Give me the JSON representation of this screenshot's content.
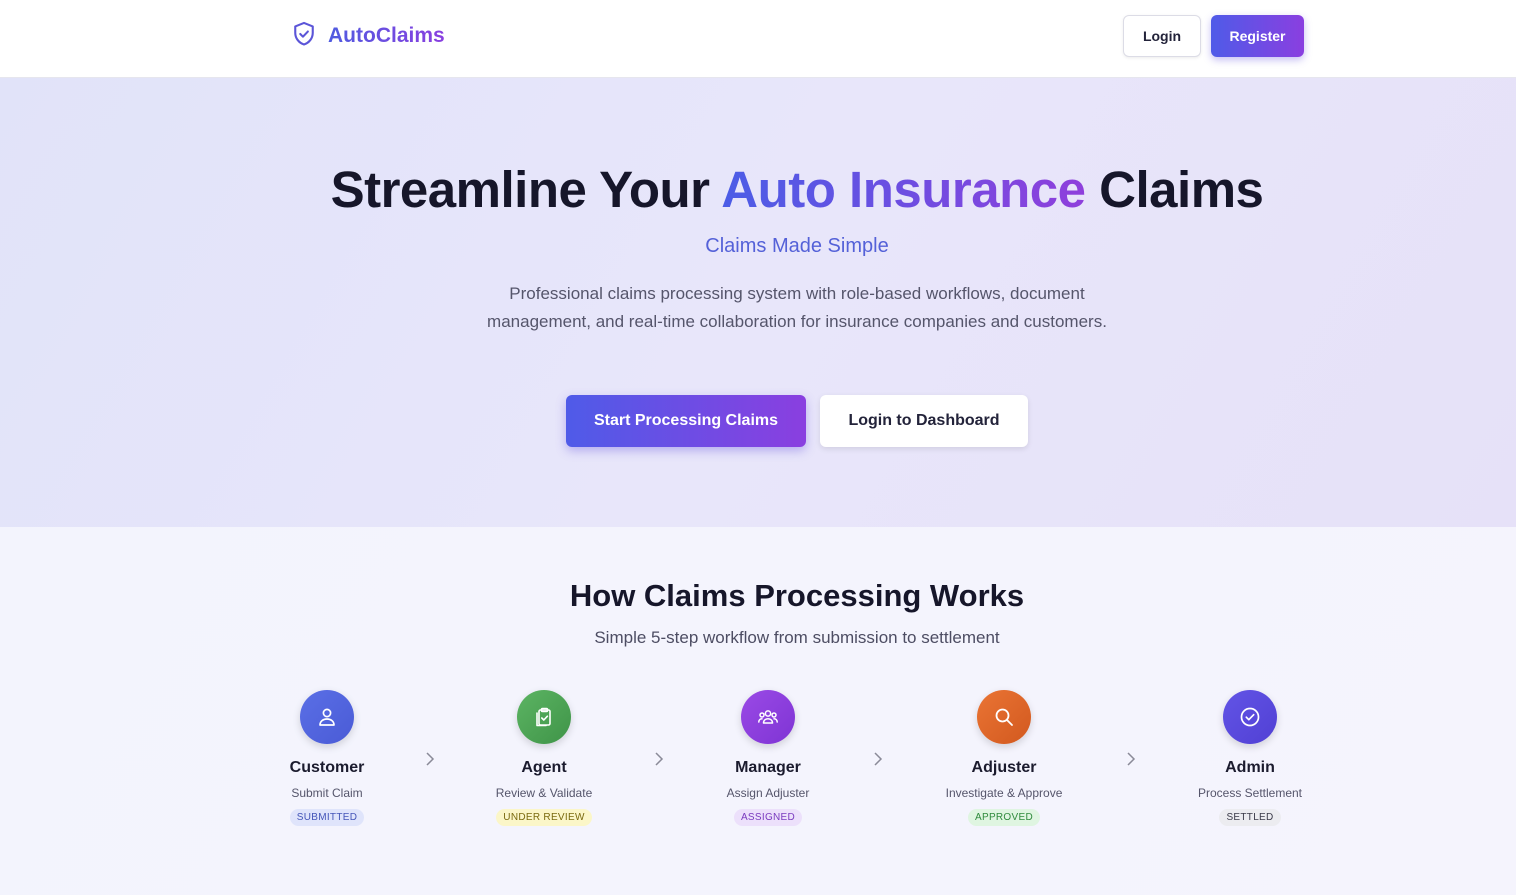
{
  "header": {
    "brand": "AutoClaims",
    "login_label": "Login",
    "register_label": "Register"
  },
  "hero": {
    "title_part1": "Streamline Your ",
    "title_accent": "Auto Insurance",
    "title_part2": " Claims",
    "subtitle": "Claims Made Simple",
    "description": "Professional claims processing system with role-based workflows, document management, and real-time collaboration for insurance companies and customers.",
    "primary_cta": "Start Processing Claims",
    "secondary_cta": "Login to Dashboard"
  },
  "how": {
    "title": "How Claims Processing Works",
    "subtitle": "Simple 5-step workflow from submission to settlement",
    "steps": [
      {
        "role": "Customer",
        "action": "Submit Claim",
        "status": "SUBMITTED",
        "icon": "user-icon",
        "color": "#5166e0",
        "badge_bg": "#dfe4fb",
        "badge_fg": "#4455b8"
      },
      {
        "role": "Agent",
        "action": "Review & Validate",
        "status": "UNDER REVIEW",
        "icon": "clipboard-check-icon",
        "color": "#4fa356",
        "badge_bg": "#fbf6c8",
        "badge_fg": "#7a6a10"
      },
      {
        "role": "Manager",
        "action": "Assign Adjuster",
        "status": "ASSIGNED",
        "icon": "team-icon",
        "color": "#8b3fe0",
        "badge_bg": "#ece0fb",
        "badge_fg": "#7a3bbf"
      },
      {
        "role": "Adjuster",
        "action": "Investigate & Approve",
        "status": "APPROVED",
        "icon": "search-icon",
        "color": "#e0662a",
        "badge_bg": "#dff5e1",
        "badge_fg": "#2f8a3c"
      },
      {
        "role": "Admin",
        "action": "Process Settlement",
        "status": "SETTLED",
        "icon": "check-circle-icon",
        "color": "#5a4fe0",
        "badge_bg": "#ececf0",
        "badge_fg": "#3a3a48"
      }
    ]
  }
}
